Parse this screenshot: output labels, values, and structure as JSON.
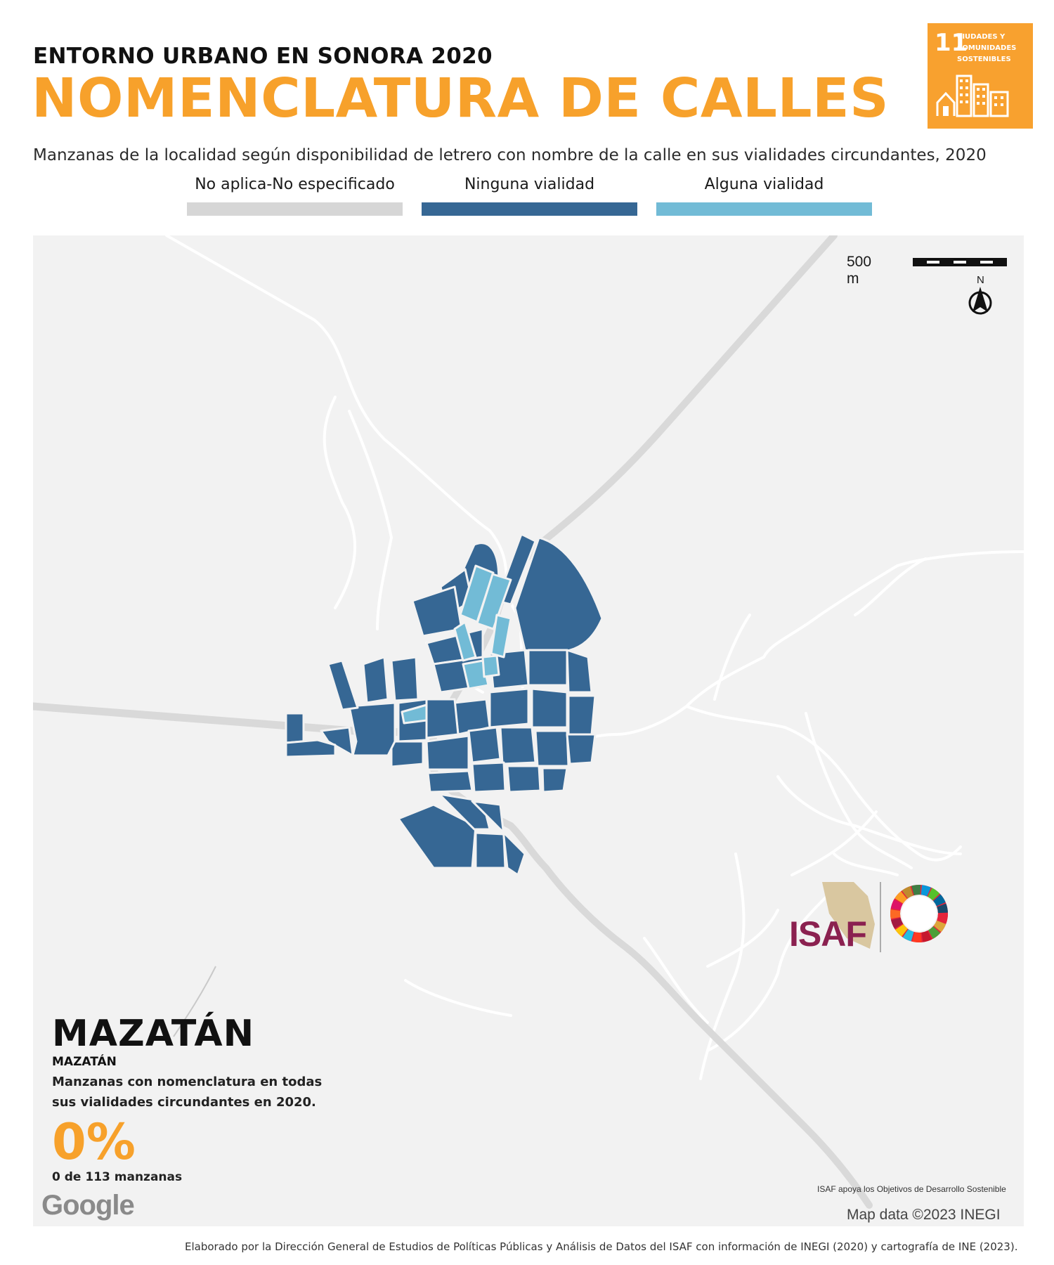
{
  "header": {
    "kicker": "ENTORNO URBANO EN SONORA 2020",
    "title": "NOMENCLATURA DE CALLES",
    "subtitle": "Manzanas de la localidad según disponibilidad de letrero con nombre de la calle en sus vialidades circundantes, 2020"
  },
  "sdg_badge": {
    "number": "11",
    "label_lines": [
      "CIUDADES Y",
      "COMUNIDADES",
      "SOSTENIBLES"
    ],
    "color": "#f8a12f",
    "icon": "city-buildings-icon"
  },
  "legend": [
    {
      "label": "No aplica-No especificado",
      "color": "#d6d6d6"
    },
    {
      "label": "Ninguna vialidad",
      "color": "#366794"
    },
    {
      "label": "Alguna vialidad",
      "color": "#72bbd6"
    }
  ],
  "map": {
    "scale_label": "500 m",
    "north_label": "N",
    "attribution": "Map data ©2023 INEGI",
    "provider": "Google",
    "background": "#f2f2f2",
    "road_color": "#d9d9d9"
  },
  "summary": {
    "locality": "MAZATÁN",
    "municipality": "MAZATÁN",
    "description": "Manzanas con nomenclatura en todas sus vialidades circundantes en 2020.",
    "percent": "0%",
    "count_text": "0 de 113 manzanas"
  },
  "logos": {
    "isaf": "ISAF",
    "isaf_note": "ISAF apoya los Objetivos de Desarrollo Sostenible"
  },
  "footer": "Elaborado por la Dirección General de Estudios de Políticas Públicas y Análisis de Datos del ISAF con información de INEGI (2020) y cartografía de INE (2023)."
}
